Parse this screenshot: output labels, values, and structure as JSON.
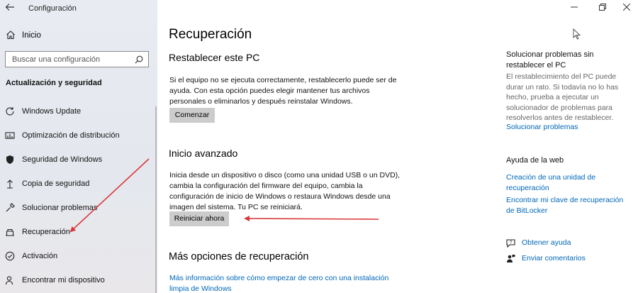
{
  "window": {
    "title": "Configuración"
  },
  "sidebar": {
    "home_label": "Inicio",
    "search_placeholder": "Buscar una configuración",
    "section_title": "Actualización y seguridad",
    "items": [
      {
        "label": "Windows Update",
        "icon": "refresh-icon"
      },
      {
        "label": "Optimización de distribución",
        "icon": "delivery-optimization-icon"
      },
      {
        "label": "Seguridad de Windows",
        "icon": "shield-icon"
      },
      {
        "label": "Copia de seguridad",
        "icon": "backup-arrow-icon"
      },
      {
        "label": "Solucionar problemas",
        "icon": "wrench-icon"
      },
      {
        "label": "Recuperación",
        "icon": "recovery-icon"
      },
      {
        "label": "Activación",
        "icon": "check-circle-icon"
      },
      {
        "label": "Encontrar mi dispositivo",
        "icon": "person-location-icon"
      }
    ]
  },
  "main": {
    "title": "Recuperación",
    "reset": {
      "heading": "Restablecer este PC",
      "description": "Si el equipo no se ejecuta correctamente, restablecerlo puede ser de ayuda. Con esta opción puedes elegir mantener tus archivos personales o eliminarlos y después reinstalar Windows.",
      "button": "Comenzar"
    },
    "advanced": {
      "heading": "Inicio avanzado",
      "description": "Inicia desde un dispositivo o disco (como una unidad USB o un DVD), cambia la configuración del firmware del equipo, cambia la configuración de inicio de Windows o restaura Windows desde una imagen del sistema. Tu PC se reiniciará.",
      "button": "Reiniciar ahora"
    },
    "more": {
      "heading": "Más opciones de recuperación",
      "link": "Más información sobre cómo empezar de cero con una instalación limpia de Windows"
    }
  },
  "right_panel": {
    "troubleshoot": {
      "heading": "Solucionar problemas sin restablecer el PC",
      "description": "El restablecimiento del PC puede durar un rato. Si todavía no lo has hecho, prueba a ejecutar un solucionador de problemas para resolverlos antes de restablecer.",
      "link": "Solucionar problemas"
    },
    "web_help": {
      "heading": "Ayuda de la web",
      "links": [
        "Creación de una unidad de recuperación",
        "Encontrar mi clave de recuperación de BitLocker"
      ]
    },
    "get_help": "Obtener ayuda",
    "feedback": "Enviar comentarios"
  },
  "colors": {
    "accent": "#0067b8",
    "annotation_arrow": "#d9383a",
    "button_bg": "#cccccc"
  }
}
